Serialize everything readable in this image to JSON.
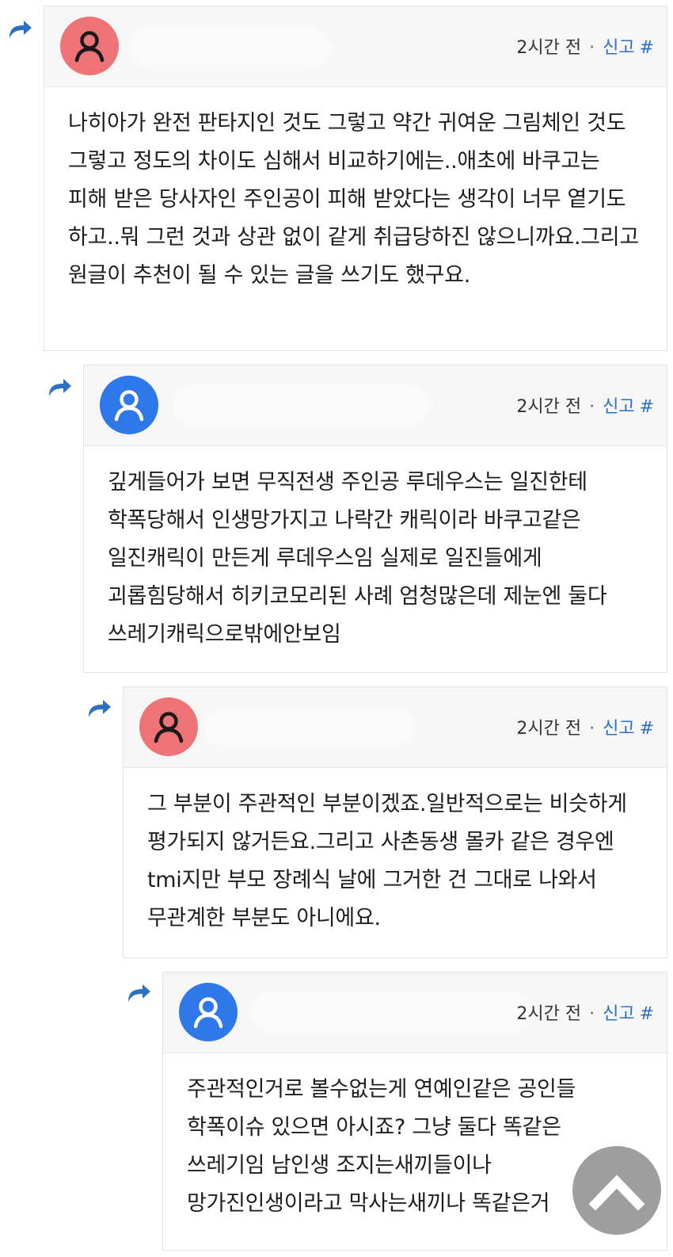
{
  "comments": [
    {
      "avatar_color": "#ee7377",
      "time": "2시간 전",
      "dot": "·",
      "report_label": "신고",
      "hash_label": "#",
      "body": "나히아가 완전 판타지인 것도 그렇고 약간 귀여운 그림체인 것도 그렇고 정도의 차이도 심해서 비교하기에는..애초에 바쿠고는 피해 받은 당사자인 주인공이 피해 받았다는 생각이 너무 옅기도 하고..뭐 그런 것과 상관 없이 같게 취급당하진 않으니까요.그리고 원글이 추천이 될 수 있는 글을 쓰기도 했구요."
    },
    {
      "avatar_color": "#2f78ea",
      "time": "2시간 전",
      "dot": "·",
      "report_label": "신고",
      "hash_label": "#",
      "body": "깊게들어가 보면 무직전생 주인공 루데우스는 일진한테 학폭당해서 인생망가지고 나락간 캐릭이라 바쿠고같은 일진캐릭이 만든게 루데우스임 실제로 일진들에게 괴롭힘당해서 히키코모리된 사례 엄청많은데 제눈엔 둘다 쓰레기캐릭으로밖에안보임"
    },
    {
      "avatar_color": "#ee7377",
      "time": "2시간 전",
      "dot": "·",
      "report_label": "신고",
      "hash_label": "#",
      "body": "그 부분이 주관적인 부분이겠죠.일반적으로는 비슷하게 평가되지 않거든요.그리고 사촌동생 몰카 같은 경우엔 tmi지만 부모 장례식 날에 그거한 건 그대로 나와서 무관계한 부분도 아니에요."
    },
    {
      "avatar_color": "#2f78ea",
      "time": "2시간 전",
      "dot": "·",
      "report_label": "신고",
      "hash_label": "#",
      "body": "주관적인거로 볼수없는게 연예인같은 공인들 학폭이슈 있으면 아시죠? 그냥 둘다 똑같은 쓰레기임 남인생 조지는새끼들이나 망가진인생이라고 막사는새끼나 똑같은거"
    }
  ]
}
